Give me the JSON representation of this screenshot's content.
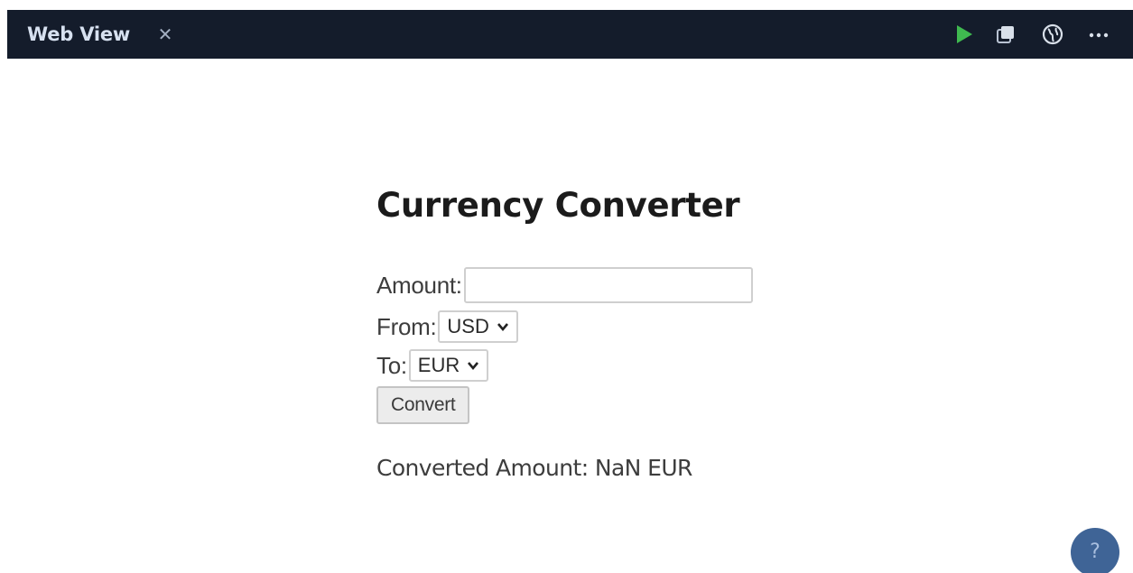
{
  "tab": {
    "title": "Web View",
    "close_symbol": "✕"
  },
  "toolbar": {
    "icons": [
      "play-icon",
      "copy-icon",
      "globe-icon",
      "more-icon"
    ],
    "play_color": "#3fb950"
  },
  "page": {
    "heading": "Currency Converter",
    "amount_label": "Amount:",
    "amount_value": "",
    "from_label": "From:",
    "from_selected": "USD",
    "to_label": "To:",
    "to_selected": "EUR",
    "convert_label": "Convert",
    "result_text": "Converted Amount: NaN EUR"
  },
  "help": {
    "symbol": "?"
  }
}
